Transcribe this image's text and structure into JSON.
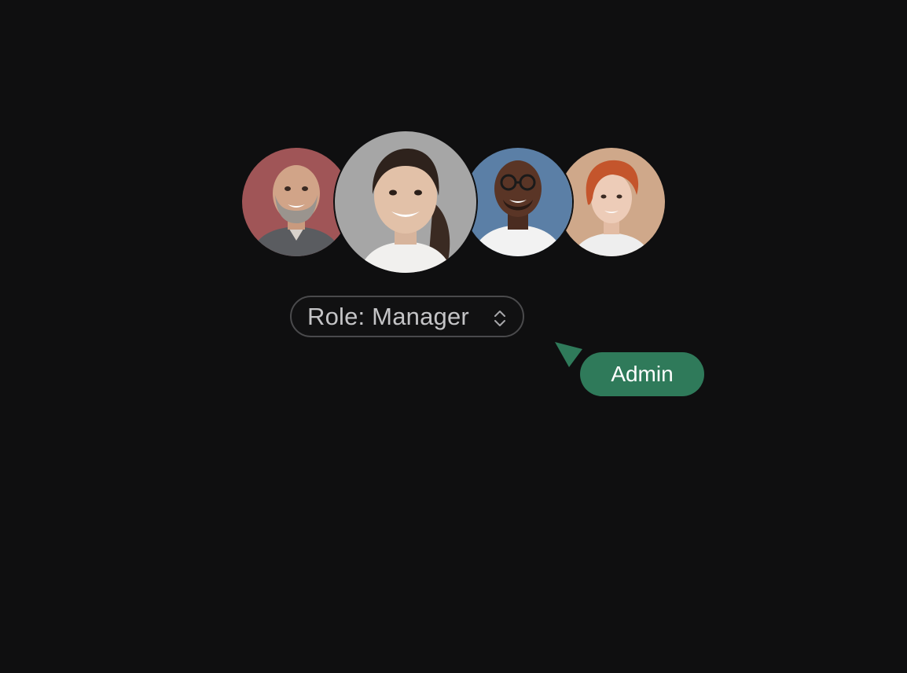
{
  "avatars": [
    {
      "name": "avatar-1",
      "bg": "#a05557",
      "icon": "bald-bearded-man-portrait"
    },
    {
      "name": "avatar-2",
      "bg": "#a6a6a6",
      "icon": "smiling-woman-ponytail-portrait"
    },
    {
      "name": "avatar-3",
      "bg": "#5b7fa6",
      "icon": "man-glasses-portrait"
    },
    {
      "name": "avatar-4",
      "bg": "#cfa88a",
      "icon": "red-haired-woman-portrait"
    }
  ],
  "role_select": {
    "value": "Role: Manager",
    "icon": "chevron-up-down-icon"
  },
  "cursor": {
    "label": "Admin",
    "color": "#2f7a5a"
  },
  "colors": {
    "background": "#0f0f10",
    "select_border": "#4a4a4c",
    "select_text": "#c4c4c6"
  }
}
